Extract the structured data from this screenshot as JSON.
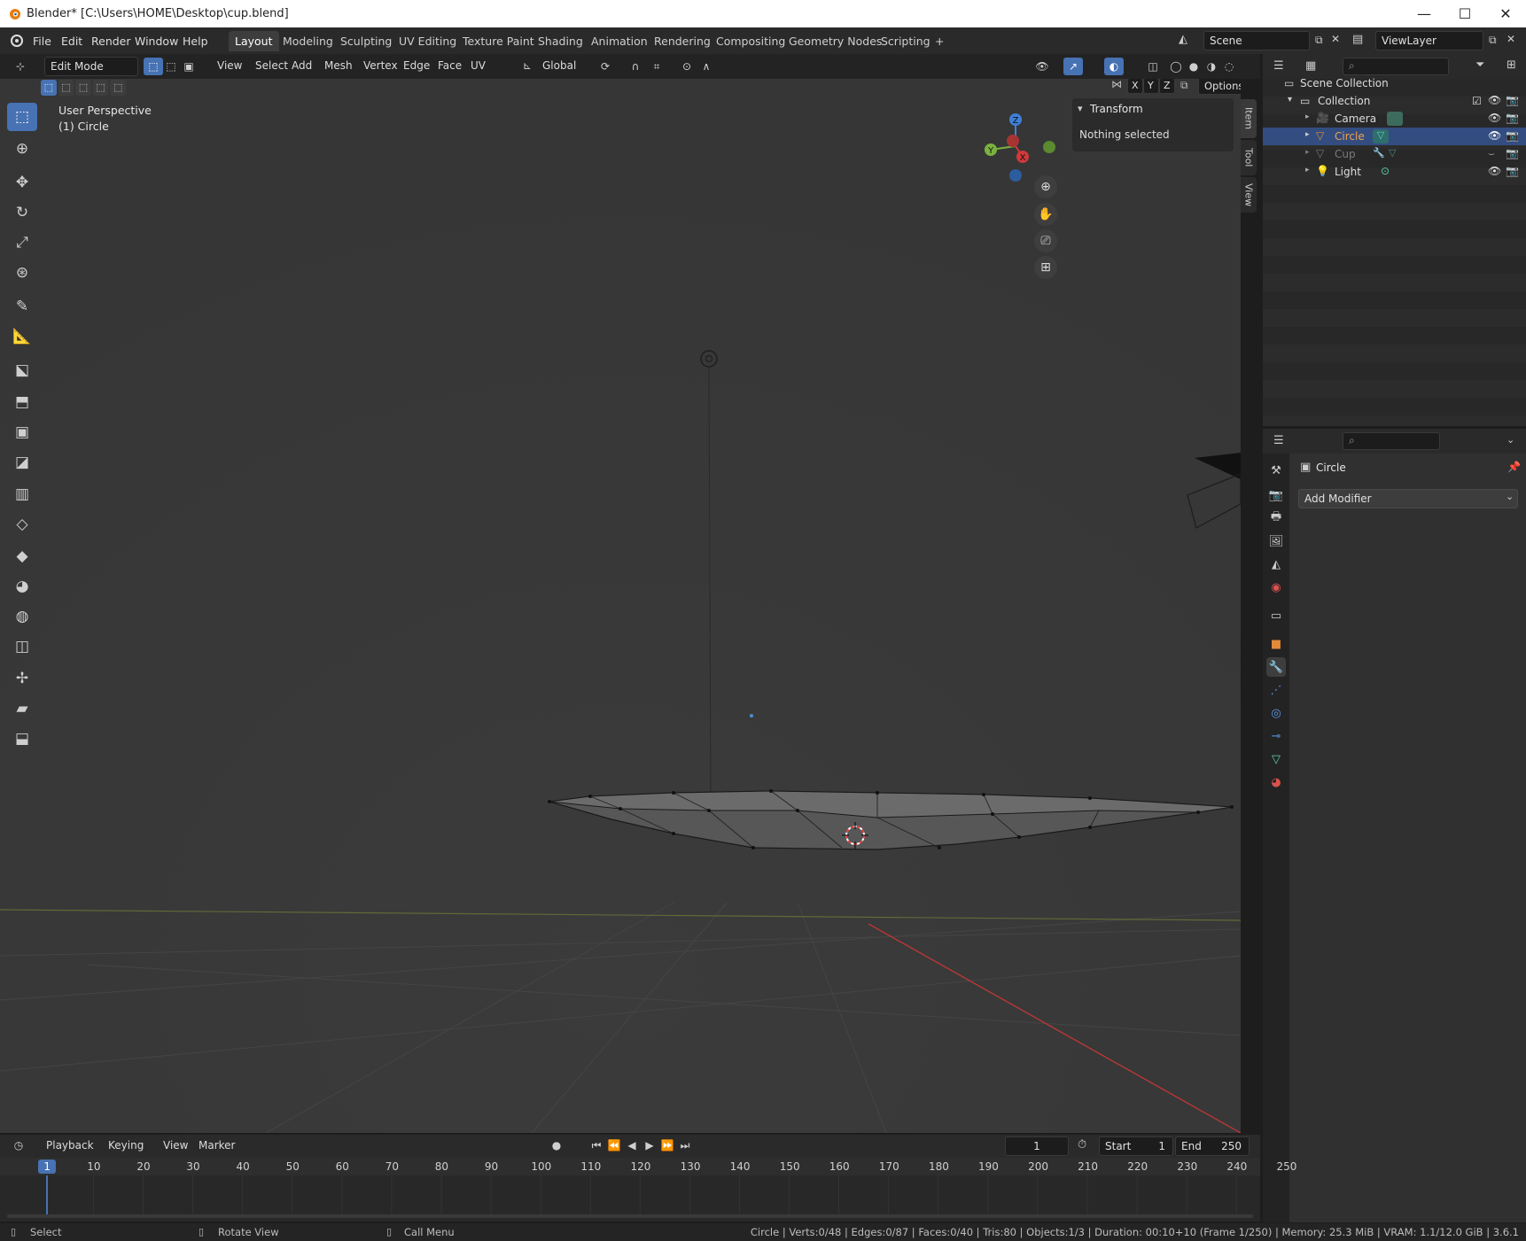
{
  "window": {
    "title": "Blender* [C:\\Users\\HOME\\Desktop\\cup.blend]",
    "minimize": "—",
    "maximize": "☐",
    "close": "✕"
  },
  "menu": {
    "items": [
      "File",
      "Edit",
      "Render",
      "Window",
      "Help"
    ],
    "workspaces": [
      "Layout",
      "Modeling",
      "Sculpting",
      "UV Editing",
      "Texture Paint",
      "Shading",
      "Animation",
      "Rendering",
      "Compositing",
      "Geometry Nodes",
      "Scripting"
    ],
    "active_workspace": "Layout",
    "add_workspace": "+",
    "scene_name": "Scene",
    "view_layer": "ViewLayer"
  },
  "viewport_header": {
    "mode": "Edit Mode",
    "menus": [
      "View",
      "Select",
      "Add",
      "Mesh",
      "Vertex",
      "Edge",
      "Face",
      "UV"
    ],
    "orientation": "Global",
    "options_label": "Options",
    "axes": [
      "X",
      "Y",
      "Z"
    ]
  },
  "viewport": {
    "view_name": "User Perspective",
    "object_label": "(1) Circle",
    "gizmo": {
      "z": "Z",
      "y": "Y",
      "x": "X"
    }
  },
  "npanel": {
    "section": "Transform",
    "status": "Nothing selected",
    "tabs": [
      "Item",
      "Tool",
      "View"
    ]
  },
  "outliner": {
    "root": "Scene Collection",
    "collection": "Collection",
    "objects": [
      {
        "name": "Camera",
        "color": "#e58a3a",
        "selected": false,
        "dim": false
      },
      {
        "name": "Circle",
        "color": "#e58a3a",
        "selected": true,
        "dim": false
      },
      {
        "name": "Cup",
        "color": "#7a7a7a",
        "selected": false,
        "dim": true
      },
      {
        "name": "Light",
        "color": "#e58a3a",
        "selected": false,
        "dim": false
      }
    ]
  },
  "properties": {
    "object_name": "Circle",
    "add_modifier": "Add Modifier"
  },
  "timeline": {
    "menus": [
      "Playback",
      "Keying",
      "View",
      "Marker"
    ],
    "current_frame": "1",
    "start_label": "Start",
    "start_value": "1",
    "end_label": "End",
    "end_value": "250",
    "ticks": [
      "1",
      "10",
      "20",
      "30",
      "40",
      "50",
      "60",
      "70",
      "80",
      "90",
      "100",
      "110",
      "120",
      "130",
      "140",
      "150",
      "160",
      "170",
      "180",
      "190",
      "200",
      "210",
      "220",
      "230",
      "240",
      "250"
    ]
  },
  "statusbar": {
    "select": "Select",
    "rotate": "Rotate View",
    "call_menu": "Call Menu",
    "stats": "Circle | Verts:0/48 | Edges:0/87 | Faces:0/40 | Tris:80 | Objects:1/3 | Duration: 00:10+10 (Frame 1/250) | Memory: 25.3 MiB | VRAM: 1.1/12.0 GiB | 3.6.1"
  },
  "colors": {
    "accent": "#4772b3",
    "x_axis": "#d03a3a",
    "y_axis": "#7ab340",
    "z_axis": "#3f7fd6"
  }
}
